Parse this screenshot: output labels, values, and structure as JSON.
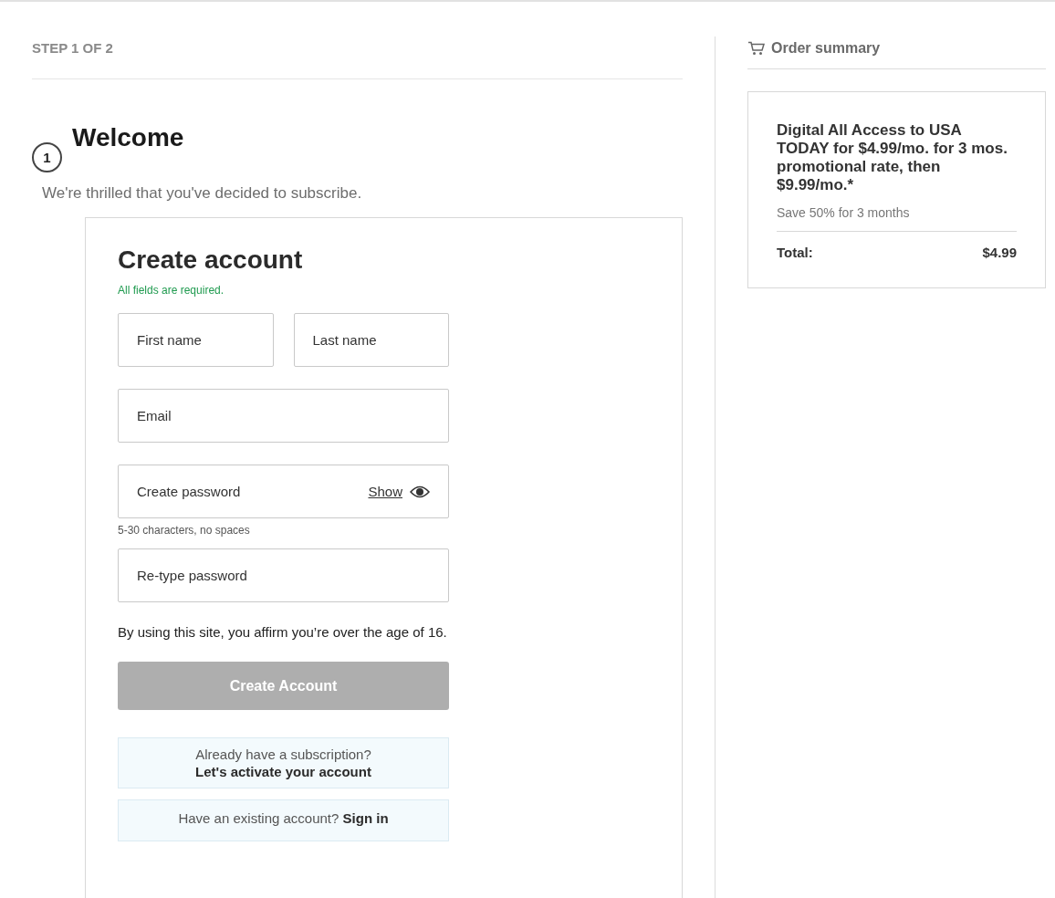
{
  "step": "STEP 1 OF 2",
  "step_number": "1",
  "title": "Welcome",
  "subtitle": "We're thrilled that you've decided to subscribe.",
  "form": {
    "title": "Create account",
    "required_note": "All fields are required.",
    "name_fields": [
      {
        "placeholder": "First name"
      },
      {
        "placeholder": "Last name"
      }
    ],
    "email": {
      "placeholder": "Email"
    },
    "password": {
      "placeholder": "Create password",
      "toggle": "Show",
      "hint": "5-30 characters, no spaces"
    },
    "retype_password": {
      "placeholder": "Re-type password"
    },
    "age_notice": "By using this site, you affirm you’re over the age of 16.",
    "submit": {
      "label": "Create Account",
      "disabled": true
    },
    "activate_box": {
      "question": "Already have a subscription?",
      "link": "Let's activate your account"
    },
    "signin_box": {
      "question": "Have an existing account?",
      "link": "Sign in"
    }
  },
  "order_summary": {
    "title": "Order summary",
    "offer": "Digital All Access to USA TODAY for $4.99/mo. for 3 mos. promotional rate, then $9.99/mo.*",
    "savings": "Save 50% for 3 months",
    "total_label": "Total:",
    "total_value": "$4.99"
  }
}
